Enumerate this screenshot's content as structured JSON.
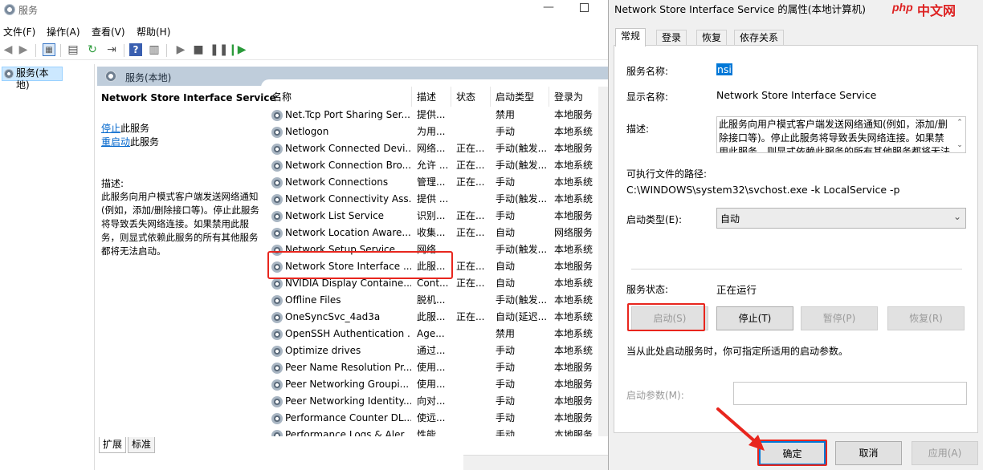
{
  "window": {
    "title": "服务"
  },
  "menu": [
    "文件(F)",
    "操作(A)",
    "查看(V)",
    "帮助(H)"
  ],
  "tree": {
    "item": "服务(本地)"
  },
  "content": {
    "header": "服务(本地)",
    "service_title": "Network Store Interface Service",
    "stop_link": "停止",
    "stop_suffix": "此服务",
    "restart_link": "重启动",
    "restart_suffix": "此服务",
    "desc_label": "描述:",
    "desc_text": "此服务向用户模式客户端发送网络通知(例如，添加/删除接口等)。停止此服务将导致丢失网络连接。如果禁用此服务，则显式依赖此服务的所有其他服务都将无法启动。"
  },
  "list": {
    "columns": [
      "名称",
      "描述",
      "状态",
      "启动类型",
      "登录为"
    ],
    "rows": [
      [
        "Net.Tcp Port Sharing Ser...",
        "提供...",
        "",
        "禁用",
        "本地服务"
      ],
      [
        "Netlogon",
        "为用...",
        "",
        "手动",
        "本地系统"
      ],
      [
        "Network Connected Devi...",
        "网络...",
        "正在...",
        "手动(触发...",
        "本地服务"
      ],
      [
        "Network Connection Bro...",
        "允许 ...",
        "正在...",
        "手动(触发...",
        "本地系统"
      ],
      [
        "Network Connections",
        "管理...",
        "正在...",
        "手动",
        "本地系统"
      ],
      [
        "Network Connectivity Ass...",
        "提供 ...",
        "",
        "手动(触发...",
        "本地系统"
      ],
      [
        "Network List Service",
        "识别...",
        "正在...",
        "手动",
        "本地服务"
      ],
      [
        "Network Location Aware...",
        "收集...",
        "正在...",
        "自动",
        "网络服务"
      ],
      [
        "Network Setup Service",
        "网络...",
        "",
        "手动(触发...",
        "本地系统"
      ],
      [
        "Network Store Interface ...",
        "此服...",
        "正在...",
        "自动",
        "本地服务"
      ],
      [
        "NVIDIA Display Containe...",
        "Cont...",
        "正在...",
        "自动",
        "本地系统"
      ],
      [
        "Offline Files",
        "脱机...",
        "",
        "手动(触发...",
        "本地系统"
      ],
      [
        "OneSyncSvc_4ad3a",
        "此服...",
        "正在...",
        "自动(延迟...",
        "本地系统"
      ],
      [
        "OpenSSH Authentication ...",
        "Age...",
        "",
        "禁用",
        "本地系统"
      ],
      [
        "Optimize drives",
        "通过...",
        "",
        "手动",
        "本地系统"
      ],
      [
        "Peer Name Resolution Pr...",
        "使用...",
        "",
        "手动",
        "本地服务"
      ],
      [
        "Peer Networking Groupi...",
        "使用...",
        "",
        "手动",
        "本地服务"
      ],
      [
        "Peer Networking Identity...",
        "向对...",
        "",
        "手动",
        "本地服务"
      ],
      [
        "Performance Counter DL...",
        "使远...",
        "",
        "手动",
        "本地服务"
      ],
      [
        "Performance Logs & Aler...",
        "性能...",
        "",
        "手动",
        "本地服务"
      ]
    ]
  },
  "bottom_tabs": [
    "扩展",
    "标准"
  ],
  "dialog": {
    "title": "Network Store Interface Service 的属性(本地计算机)",
    "logo_php": "php",
    "logo_zh": "中文网",
    "tabs": [
      "常规",
      "登录",
      "恢复",
      "依存关系"
    ],
    "service_name_label": "服务名称:",
    "service_name": "nsi",
    "display_name_label": "显示名称:",
    "display_name": "Network Store Interface Service",
    "description_label": "描述:",
    "description": "此服务向用户模式客户端发送网络通知(例如，添加/删除接口等)。停止此服务将导致丢失网络连接。如果禁用此服务，则显式依赖此服务的所有其他服务都将无法启动。",
    "exe_path_label": "可执行文件的路径:",
    "exe_path": "C:\\WINDOWS\\system32\\svchost.exe -k LocalService -p",
    "startup_type_label": "启动类型(E):",
    "startup_type": "自动",
    "status_label": "服务状态:",
    "status": "正在运行",
    "btn_start": "启动(S)",
    "btn_stop": "停止(T)",
    "btn_pause": "暂停(P)",
    "btn_resume": "恢复(R)",
    "hint": "当从此处启动服务时，你可指定所适用的启动参数。",
    "params_label": "启动参数(M):",
    "params_value": "",
    "btn_ok": "确定",
    "btn_cancel": "取消",
    "btn_apply": "应用(A)"
  },
  "colors": {
    "highlight": "#e8261e",
    "selection": "#0078d7",
    "header_bg": "#bfcddb"
  }
}
